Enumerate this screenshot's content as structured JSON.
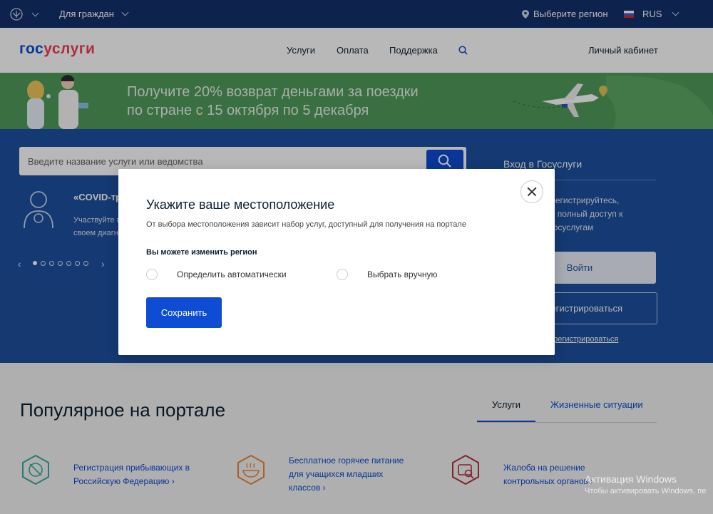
{
  "topbar": {
    "citizens": "Для граждан",
    "region": "Выберите регион",
    "lang": "RUS"
  },
  "header": {
    "logo_a": "гос",
    "logo_b": "услуги",
    "nav": [
      "Услуги",
      "Оплата",
      "Поддержка"
    ],
    "account": "Личный кабинет"
  },
  "banner": {
    "line1": "Получите 20% возврат деньгами за поездки",
    "line2": "по стране с 15 октября по 5 декабря"
  },
  "search": {
    "placeholder": "Введите название услуги или ведомства"
  },
  "news": {
    "title": "«COVID-тр",
    "text1": "Участвуйте в",
    "text2": "своем диагн"
  },
  "login": {
    "title": "Вход в Госуслуги",
    "text": "зарегистрируйтесь, ить полный доступ к м госуслугам",
    "login_button": "Войти",
    "register_button": "егистрироваться",
    "register_link": "арегистрироваться"
  },
  "modal": {
    "title": "Укажите ваше местоположение",
    "subtitle": "От выбора местоположения зависит набор услуг, доступный для получения на портале",
    "change_label": "Вы можете изменить регион",
    "option_auto": "Определить автоматически",
    "option_manual": "Выбрать вручную",
    "save": "Сохранить"
  },
  "popular": {
    "title": "Популярное на портале",
    "tabs": [
      "Услуги",
      "Жизненные ситуации"
    ],
    "items": [
      {
        "line1": "Регистрация прибывающих в",
        "line2": "Российскую Федерацию ›"
      },
      {
        "line1": "Бесплатное горячее питание",
        "line2": "для учащихся младших",
        "line3": "классов ›"
      },
      {
        "line1": "Жалоба на решение",
        "line2": "контрольных органов ›"
      }
    ]
  },
  "watermark": {
    "line1": "Активация Windows",
    "line2": "Чтобы активировать Windows, пе"
  },
  "colors": {
    "topbar": "#12306b",
    "primary": "#0d4cd3",
    "blue_area": "#1e4f9e",
    "banner": "#4f9a5b",
    "logo_red": "#ee3f58"
  }
}
